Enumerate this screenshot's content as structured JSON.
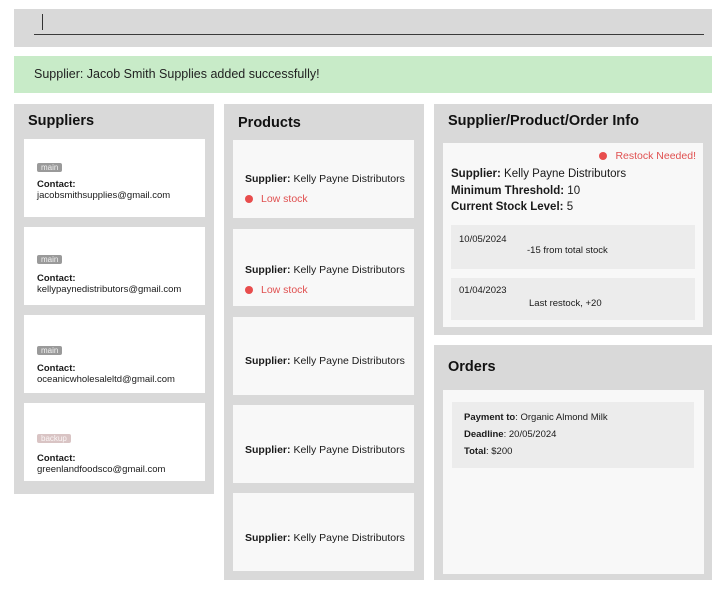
{
  "command_box": {
    "value": "",
    "placeholder": ""
  },
  "result_message": "Supplier: Jacob Smith Supplies added successfully!",
  "suppliers_panel": {
    "title": "Suppliers",
    "contact_label": "Contact:",
    "items": [
      {
        "tag": "main",
        "email": "jacobsmithsupplies@gmail.com"
      },
      {
        "tag": "main",
        "email": "kellypaynedistributors@gmail.com"
      },
      {
        "tag": "main",
        "email": "oceanicwholesaleltd@gmail.com"
      },
      {
        "tag": "backup",
        "email": "greenlandfoodsco@gmail.com"
      }
    ]
  },
  "products_panel": {
    "title": "Products",
    "supplier_label": "Supplier:",
    "low_stock_label": "Low stock",
    "items": [
      {
        "supplier": "Kelly Payne Distributors",
        "low_stock": true
      },
      {
        "supplier": "Kelly Payne Distributors",
        "low_stock": true
      },
      {
        "supplier": "Kelly Payne Distributors",
        "low_stock": false
      },
      {
        "supplier": "Kelly Payne Distributors",
        "low_stock": false
      },
      {
        "supplier": "Kelly Payne Distributors",
        "low_stock": false
      }
    ]
  },
  "info_panel": {
    "title": "Supplier/Product/Order Info",
    "alert": "Restock Needed!",
    "supplier_label": "Supplier:",
    "supplier": "Kelly Payne Distributors",
    "min_threshold_label": "Minimum Threshold:",
    "min_threshold": "10",
    "stock_label": "Current Stock Level:",
    "stock": "5",
    "history": [
      {
        "date": "10/05/2024",
        "description": "-15 from total stock"
      },
      {
        "date": "01/04/2023",
        "description": "Last restock, +20"
      }
    ]
  },
  "orders_panel": {
    "title": "Orders",
    "payment_label": "Payment to",
    "payment": ": Organic Almond Milk",
    "deadline_label": "Deadline",
    "deadline": ": 20/05/2024",
    "total_label": "Total",
    "total": ": $200"
  },
  "colors": {
    "panel_bg": "#d9d9d9",
    "success_bg": "#c8ebc8",
    "alert_red": "#e84d4d",
    "tag_main": "#9a9a9a",
    "tag_backup": "#d9c4c4"
  }
}
